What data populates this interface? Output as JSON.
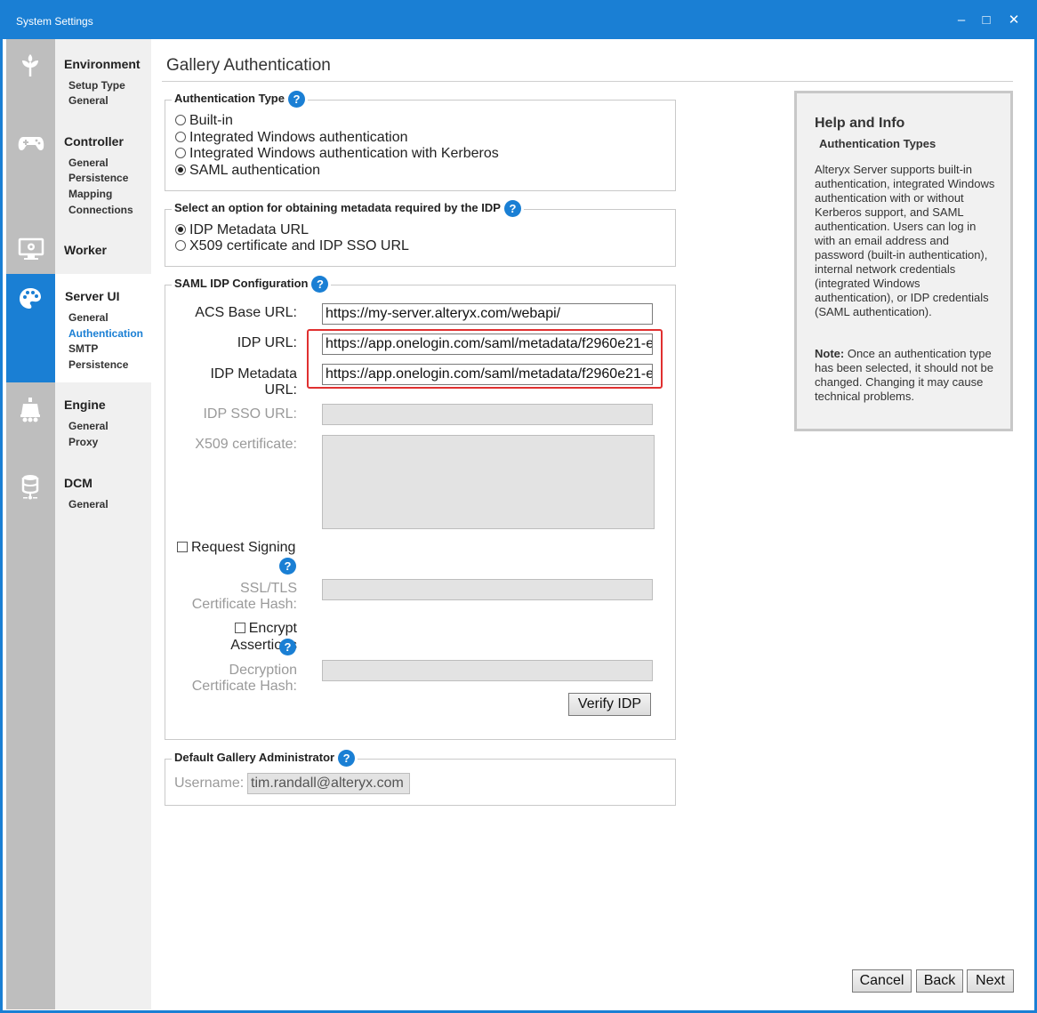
{
  "window": {
    "title": "System Settings"
  },
  "icons": {
    "environment": "plant-icon",
    "controller": "gamepad-icon",
    "worker": "monitor-gear-icon",
    "server_ui": "palette-icon",
    "engine": "engine-icon",
    "dcm": "database-icon"
  },
  "nav": {
    "environment": {
      "label": "Environment",
      "items": [
        "Setup Type",
        "General"
      ]
    },
    "controller": {
      "label": "Controller",
      "items": [
        "General",
        "Persistence",
        "Mapping",
        "Connections"
      ]
    },
    "worker": {
      "label": "Worker"
    },
    "server_ui": {
      "label": "Server UI",
      "items": [
        "General",
        "Authentication",
        "SMTP",
        "Persistence"
      ]
    },
    "engine": {
      "label": "Engine",
      "items": [
        "General",
        "Proxy"
      ]
    },
    "dcm": {
      "label": "DCM",
      "items": [
        "General"
      ]
    }
  },
  "page": {
    "title": "Gallery Authentication"
  },
  "auth_type": {
    "legend": "Authentication Type",
    "options": [
      "Built-in",
      "Integrated Windows authentication",
      "Integrated Windows authentication with Kerberos",
      "SAML authentication"
    ],
    "selected": "SAML authentication"
  },
  "metadata_option": {
    "legend": "Select an option for obtaining metadata required by the IDP",
    "options": [
      "IDP Metadata URL",
      "X509 certificate and IDP SSO URL"
    ],
    "selected": "IDP Metadata URL"
  },
  "saml": {
    "legend": "SAML IDP Configuration",
    "acs_label": "ACS Base URL:",
    "acs_value": "https://my-server.alteryx.com/webapi/",
    "idp_url_label": "IDP URL:",
    "idp_url_value": "https://app.onelogin.com/saml/metadata/f2960e21-e",
    "idp_meta_label_1": "IDP Metadata",
    "idp_meta_label_2": "URL:",
    "idp_meta_value": "https://app.onelogin.com/saml/metadata/f2960e21-e",
    "sso_label": "IDP SSO URL:",
    "x509_label": "X509 certificate:",
    "request_signing": "Request Signing",
    "ssl_label_1": "SSL/TLS",
    "ssl_label_2": "Certificate Hash:",
    "encrypt_1": "Encrypt",
    "encrypt_2": "Assertions",
    "decrypt_label_1": "Decryption",
    "decrypt_label_2": "Certificate Hash:",
    "verify_button": "Verify IDP"
  },
  "admin": {
    "legend": "Default Gallery Administrator",
    "username_label": "Username:",
    "username_value": "tim.randall@alteryx.com"
  },
  "help": {
    "heading": "Help and Info",
    "subheading": "Authentication Types",
    "body": "Alteryx Server supports built-in authentication, integrated Windows authentication with or without Kerberos support, and SAML authentication. Users can log in with an email address and password (built-in authentication), internal network credentials (integrated Windows authentication), or IDP credentials (SAML authentication).",
    "note_label": "Note:",
    "note_text": " Once an authentication type has been selected, it should not be changed. Changing it may cause technical problems."
  },
  "footer": {
    "cancel": "Cancel",
    "back": "Back",
    "next": "Next"
  },
  "colors": {
    "accent": "#1a7fd4",
    "highlight": "#e03030",
    "rail": "#bebebe",
    "nav": "#f0f0f0"
  }
}
